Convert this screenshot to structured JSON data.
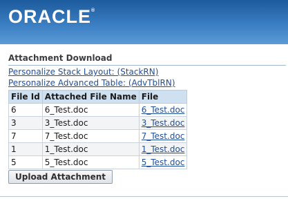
{
  "header": {
    "logo_text": "ORACLE",
    "logo_mark": "®"
  },
  "page": {
    "title": "Attachment Download"
  },
  "links": {
    "personalize_stack": "Personalize Stack Layout: (StackRN)",
    "personalize_table": "Personalize Advanced Table: (AdvTblRN)"
  },
  "table": {
    "columns": [
      "File Id",
      "Attached File Name",
      "File"
    ],
    "rows": [
      {
        "file_id": "6",
        "name": "6_Test.doc",
        "file": "6_Test.doc"
      },
      {
        "file_id": "3",
        "name": "3_Test.doc",
        "file": "3_Test.doc"
      },
      {
        "file_id": "7",
        "name": "7_Test.doc",
        "file": "7_Test.doc"
      },
      {
        "file_id": "1",
        "name": "1_Test.doc",
        "file": "1_Test.doc"
      },
      {
        "file_id": "5",
        "name": "5_Test.doc",
        "file": "5_Test.doc"
      }
    ]
  },
  "buttons": {
    "upload": "Upload Attachment"
  },
  "colors": {
    "banner": "#2f6fb3",
    "link": "#1f4e9a",
    "header_cell": "#cfe0f1"
  }
}
